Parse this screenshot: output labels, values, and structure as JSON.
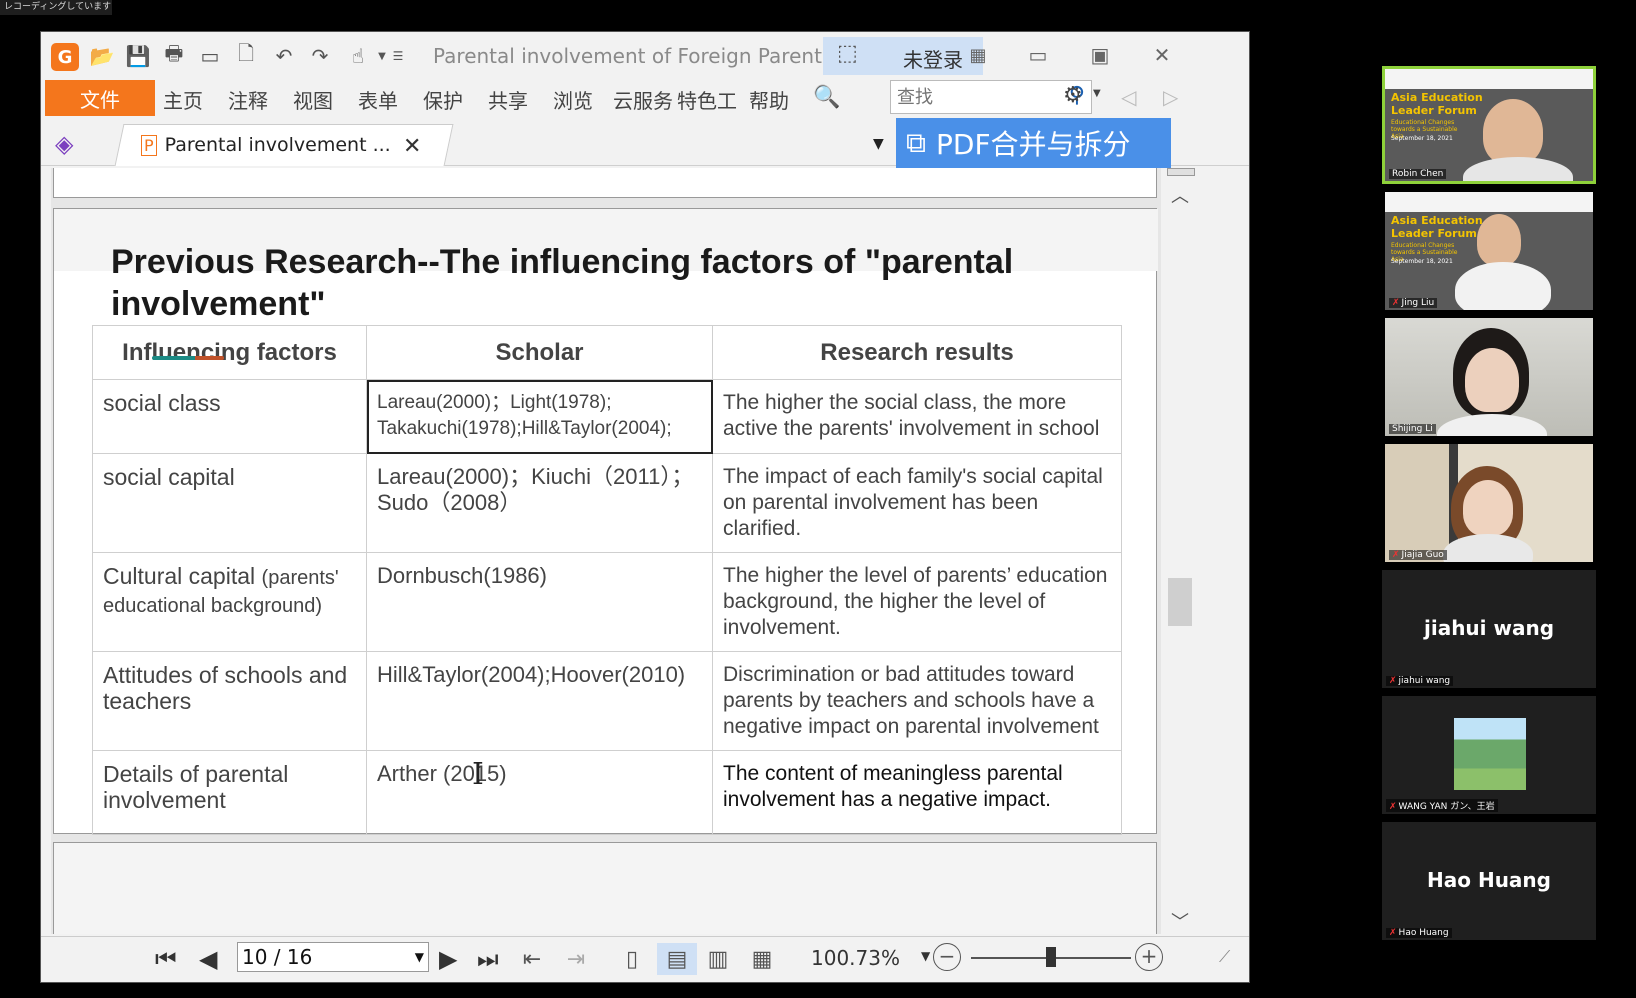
{
  "recording_badge": "レコーディングしています...",
  "window": {
    "title": "Parental involvement of Foreign Parent...",
    "login_label": "未登录"
  },
  "menu": {
    "file": "文件",
    "items": [
      "主页",
      "注释",
      "视图",
      "表单",
      "保护",
      "共享",
      "浏览",
      "云服务",
      "特色工",
      "帮助"
    ]
  },
  "search": {
    "placeholder": "查找"
  },
  "tab": {
    "label": "Parental involvement ..."
  },
  "banner": {
    "label": "PDF合并与拆分"
  },
  "slide": {
    "title": "Previous Research--The influencing factors of \"parental involvement\"",
    "headers": [
      "Influencing factors",
      "Scholar",
      "Research results"
    ],
    "rows": [
      {
        "factor": "social class",
        "factor_extra": "",
        "scholar": "Lareau(2000)；Light(1978); Takakuchi(1978);Hill&Taylor(2004);",
        "result": "The higher the social class, the more active the parents' involvement in school"
      },
      {
        "factor": "social capital",
        "factor_extra": "",
        "scholar": "Lareau(2000)；Kiuchi（2011）；Sudo（2008）",
        "result": "The impact of each family's social capital on parental involvement  has been clarified."
      },
      {
        "factor": "Cultural capital",
        "factor_extra": "(parents' educational background)",
        "scholar": "Dornbusch(1986)",
        "result": "The higher the level of parents’ education background, the higher the level of involvement."
      },
      {
        "factor": "Attitudes of schools and teachers",
        "factor_extra": "",
        "scholar": "Hill&Taylor(2004);Hoover(2010)",
        "result": "Discrimination or  bad attitudes toward parents by teachers and schools have a negative impact on parental involvement"
      },
      {
        "factor": "Details of parental involvement",
        "factor_extra": "",
        "scholar": "Arther (2015)",
        "result": "The content of meaningless parental involvement has a negative impact."
      }
    ]
  },
  "status": {
    "page_indicator": "10 / 16",
    "zoom": "100.73%",
    "zoom_level_fraction": 0.5
  },
  "participants": [
    {
      "name": "Robin Chen",
      "kind": "forum",
      "active": true,
      "muted": false
    },
    {
      "name": "Jing Liu",
      "kind": "forum",
      "active": false,
      "muted": true
    },
    {
      "name": "Shijing Li",
      "kind": "camera",
      "active": false,
      "muted": false
    },
    {
      "name": "Jiajia Guo",
      "kind": "camera",
      "active": false,
      "muted": true
    },
    {
      "name": "jiahui wang",
      "kind": "name",
      "active": false,
      "muted": true
    },
    {
      "name": "WANG YAN ガン、王岩",
      "kind": "image",
      "active": false,
      "muted": true
    },
    {
      "name": "Hao Huang",
      "kind": "name",
      "active": false,
      "muted": true
    }
  ],
  "forum_overlay": {
    "title": "Asia Education Leader Forum",
    "subtitle": "Educational Changes towards a Sustainable Asia",
    "date": "September 18, 2021"
  },
  "colors": {
    "accent_orange": "#f4761c",
    "banner_blue": "#4a90e8",
    "active_speaker": "#8ed13a"
  }
}
